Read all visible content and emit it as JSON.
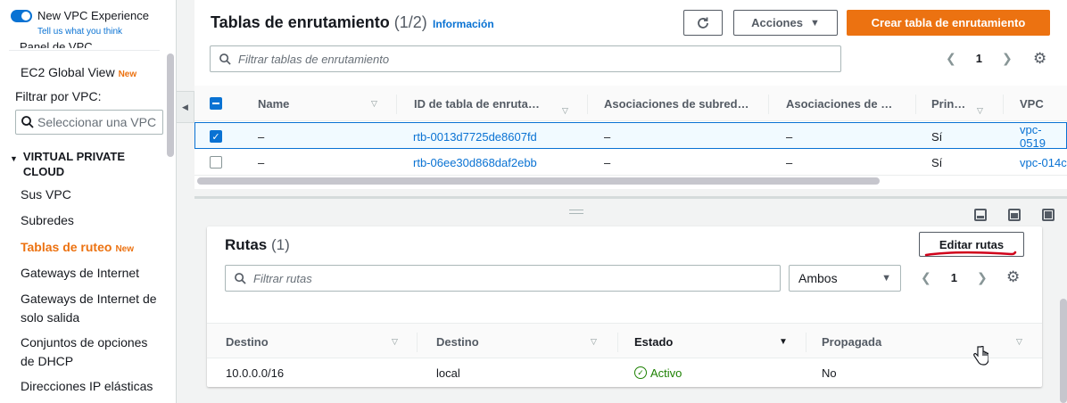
{
  "sidebar": {
    "toggle_label": "New VPC Experience",
    "feedback_link": "Tell us what you think",
    "cut_item": "Panel de VPC",
    "ec2_global": "EC2 Global View",
    "new_badge": "New",
    "filter_label": "Filtrar por VPC:",
    "vpc_select_placeholder": "Seleccionar una VPC",
    "section_title_line1": "VIRTUAL PRIVATE",
    "section_title_line2": "CLOUD",
    "items": [
      {
        "label": "Sus VPC"
      },
      {
        "label": "Subredes"
      },
      {
        "label": "Tablas de ruteo",
        "badge": "New"
      },
      {
        "label": "Gateways de Internet"
      },
      {
        "label": "Gateways de Internet de solo salida"
      },
      {
        "label": "Conjuntos de opciones de DHCP"
      },
      {
        "label": "Direcciones IP elásticas"
      }
    ]
  },
  "header": {
    "title": "Tablas de enrutamiento",
    "count": "(1/2)",
    "info": "Información",
    "actions": "Acciones",
    "create": "Crear tabla de enrutamiento",
    "search_placeholder": "Filtrar tablas de enrutamiento",
    "page": "1"
  },
  "route_tables": {
    "columns": [
      "Name",
      "ID de tabla de enruta…",
      "Asociaciones de subred…",
      "Asociaciones de …",
      "Prin…",
      "VPC"
    ],
    "rows": [
      {
        "name": "–",
        "id": "rtb-0013d7725de8607fd",
        "subnet_assoc": "–",
        "edge_assoc": "–",
        "main": "Sí",
        "vpc": "vpc-0519",
        "selected": true
      },
      {
        "name": "–",
        "id": "rtb-06ee30d868daf2ebb",
        "subnet_assoc": "–",
        "edge_assoc": "–",
        "main": "Sí",
        "vpc": "vpc-014c",
        "selected": false
      }
    ]
  },
  "routes": {
    "title": "Rutas",
    "count": "(1)",
    "edit": "Editar rutas",
    "search_placeholder": "Filtrar rutas",
    "filter_value": "Ambos",
    "page": "1",
    "columns": [
      "Destino",
      "Destino",
      "Estado",
      "Propagada"
    ],
    "rows": [
      {
        "destination": "10.0.0.0/16",
        "target": "local",
        "status": "Activo",
        "propagated": "No"
      }
    ]
  },
  "colors": {
    "accent_orange": "#ec7211",
    "link_blue": "#0972d3",
    "success_green": "#1d8102",
    "annotation_red": "#d0021b"
  }
}
